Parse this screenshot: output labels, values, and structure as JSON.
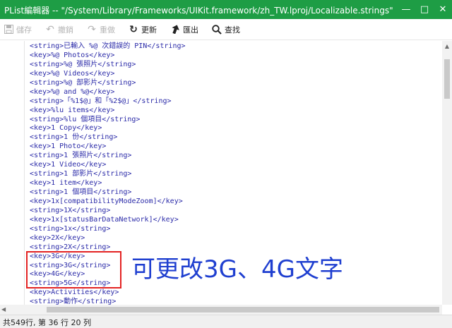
{
  "window": {
    "title": "PList編輯器  --  \"/System/Library/Frameworks/UIKit.framework/zh_TW.lproj/Localizable.strings\"",
    "minimize_icon": "minimize-icon",
    "maximize_icon": "maximize-icon",
    "close_icon": "close-icon"
  },
  "toolbar": {
    "save_label": "儲存",
    "undo_label": "撤銷",
    "redo_label": "重做",
    "refresh_label": "更新",
    "export_label": "匯出",
    "find_label": "查找"
  },
  "editor": {
    "lines": [
      "<string>已輸入 %@ 次錯誤的 PIN</string>",
      "<key>%@ Photos</key>",
      "<string>%@ 張照片</string>",
      "<key>%@ Videos</key>",
      "<string>%@ 部影片</string>",
      "<key>%@ and %@</key>",
      "<string>「%1$@」和「%2$@」</string>",
      "<key>%lu items</key>",
      "<string>%lu 個項目</string>",
      "<key>1 Copy</key>",
      "<string>1 份</string>",
      "<key>1 Photo</key>",
      "<string>1 張照片</string>",
      "<key>1 Video</key>",
      "<string>1 部影片</string>",
      "<key>1 item</key>",
      "<string>1 個項目</string>",
      "<key>1x[compatibilityModeZoom]</key>",
      "<string>1X</string>",
      "<key>1x[statusBarDataNetwork]</key>",
      "<string>1x</string>",
      "<key>2X</key>",
      "<string>2X</string>",
      "<key>3G</key>",
      "<string>3G</string>",
      "<key>4G</key>",
      "<string>5G</string>",
      "<key>Activities</key>",
      "<string>動作</string>"
    ]
  },
  "annotation": {
    "text": "可更改3G、4G文字",
    "box_color": "#e32222",
    "text_color": "#1f3fd0"
  },
  "status": {
    "text": "共549行, 第 36 行 20 列"
  },
  "colors": {
    "titlebar": "#1e9d45",
    "code_text": "#2a2aa8"
  }
}
